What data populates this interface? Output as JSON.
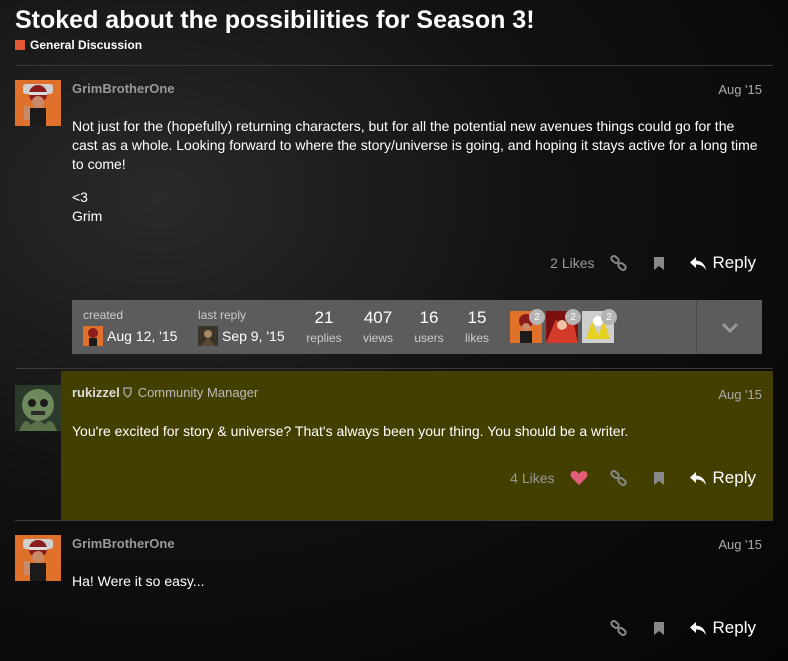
{
  "topic": {
    "title": "Stoked about the possibilities for Season 3!",
    "category": "General Discussion",
    "category_color": "#e45735"
  },
  "posts": [
    {
      "username": "GrimBrotherOne",
      "date": "Aug '15",
      "paragraphs": [
        "Not just for the (hopefully) returning characters, but for all the potential new avenues things could go for the cast as a whole. Looking forward to where the story/universe is going, and hoping it stays active for a long time to come!",
        "<3",
        "Grim"
      ],
      "likes": "2 Likes",
      "reply_label": "Reply"
    },
    {
      "username": "rukizzel",
      "title": "Community Manager",
      "date": "Aug '15",
      "text": "You're excited for story & universe? That's always been your thing. You should be a writer.",
      "likes": "4 Likes",
      "reply_label": "Reply",
      "liked_color": "#e45d7a"
    },
    {
      "username": "GrimBrotherOne",
      "date": "Aug '15",
      "text": "Ha! Were it so easy...",
      "reply_label": "Reply"
    }
  ],
  "summary": {
    "created_label": "created",
    "created_date": "Aug 12, '15",
    "last_reply_label": "last reply",
    "last_reply_date": "Sep 9, '15",
    "stats": [
      {
        "num": "21",
        "label": "replies"
      },
      {
        "num": "407",
        "label": "views"
      },
      {
        "num": "16",
        "label": "users"
      },
      {
        "num": "15",
        "label": "likes"
      }
    ],
    "participant_badges": [
      "2",
      "2",
      "2"
    ]
  },
  "colors": {
    "highlight_bg": "#423f00",
    "summary_bg": "#5c5c5c"
  }
}
